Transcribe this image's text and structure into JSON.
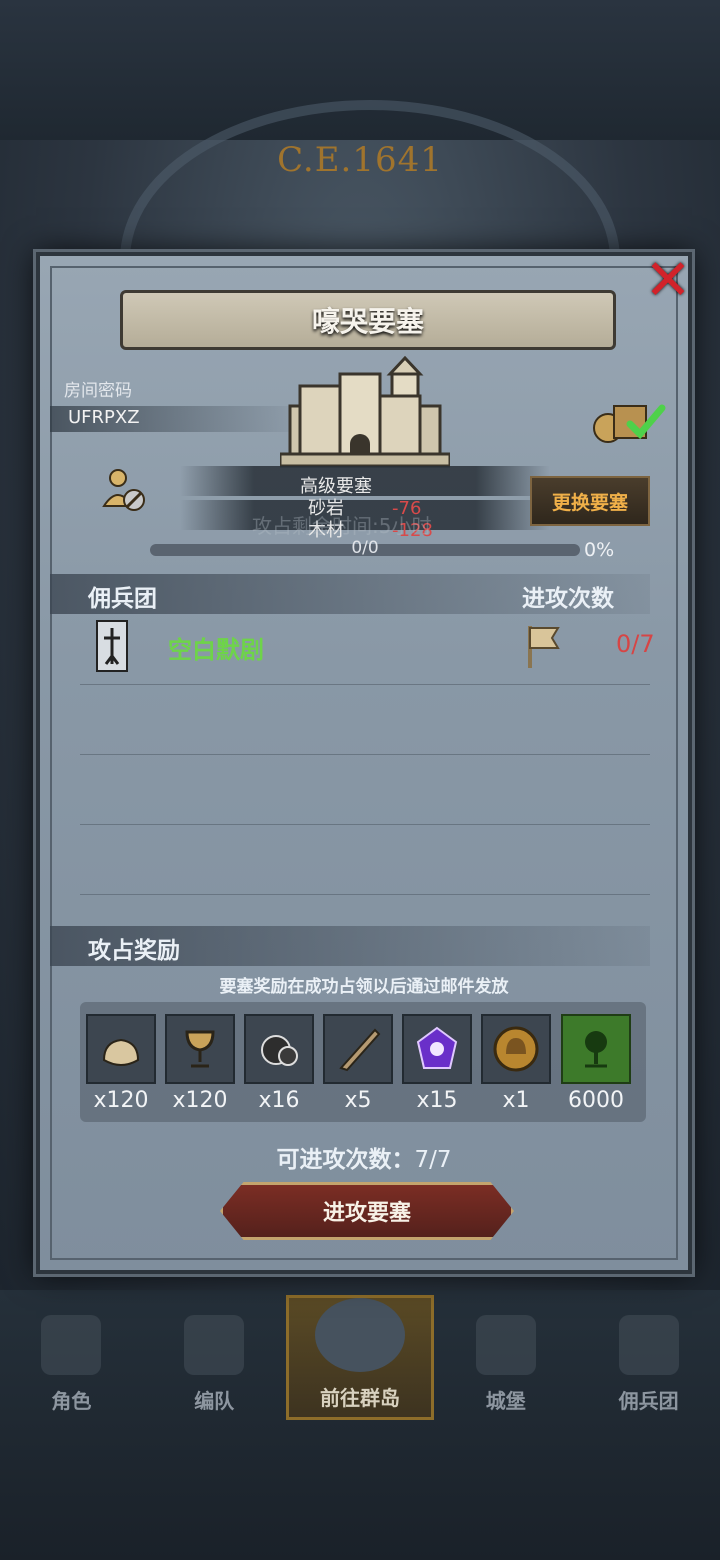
{
  "background": {
    "era_label": "C.E.1641"
  },
  "dialog": {
    "title": "嚎哭要塞",
    "room_label": "房间密码",
    "room_code": "UFRPXZ",
    "fortress_type": "高级要塞",
    "costs": [
      {
        "name": "砂岩",
        "value": "-76"
      },
      {
        "name": "木材",
        "value": "-128"
      }
    ],
    "attack_time_text": "攻占剩余时间:5小时",
    "change_button": "更换要塞",
    "progress": {
      "text": "0/0",
      "percent_label": "0%",
      "fraction": 0
    },
    "mercenary_section": {
      "left": "佣兵团",
      "right": "进攻次数"
    },
    "mercenary": {
      "name": "空白默剧",
      "count": "0/7",
      "icon": "banner-icon",
      "flag_icon": "flag-icon"
    },
    "reward_section": {
      "title": "攻占奖励",
      "note": "要塞奖励在成功占领以后通过邮件发放"
    },
    "rewards": [
      {
        "icon": "sack-icon",
        "qty": "x120"
      },
      {
        "icon": "chalice-icon",
        "qty": "x120"
      },
      {
        "icon": "ore-icon",
        "qty": "x16"
      },
      {
        "icon": "horn-icon",
        "qty": "x5"
      },
      {
        "icon": "crystal-icon",
        "qty": "x15"
      },
      {
        "icon": "helmet-coin-icon",
        "qty": "x1"
      },
      {
        "icon": "tree-banner-icon",
        "qty": "6000"
      }
    ],
    "attacks_left_label": "可进攻次数：",
    "attacks_left_value": "7/7",
    "attack_button": "进攻要塞"
  },
  "nav": {
    "items": [
      {
        "label": "角色",
        "active": false
      },
      {
        "label": "编队",
        "active": false
      },
      {
        "label": "前往群岛",
        "active": true
      },
      {
        "label": "城堡",
        "active": false
      },
      {
        "label": "佣兵团",
        "active": false
      }
    ]
  },
  "colors": {
    "accent_gold": "#f0b049",
    "merc_green": "#6ed449",
    "alert_red": "#d64545",
    "close_red": "#d2222a"
  }
}
